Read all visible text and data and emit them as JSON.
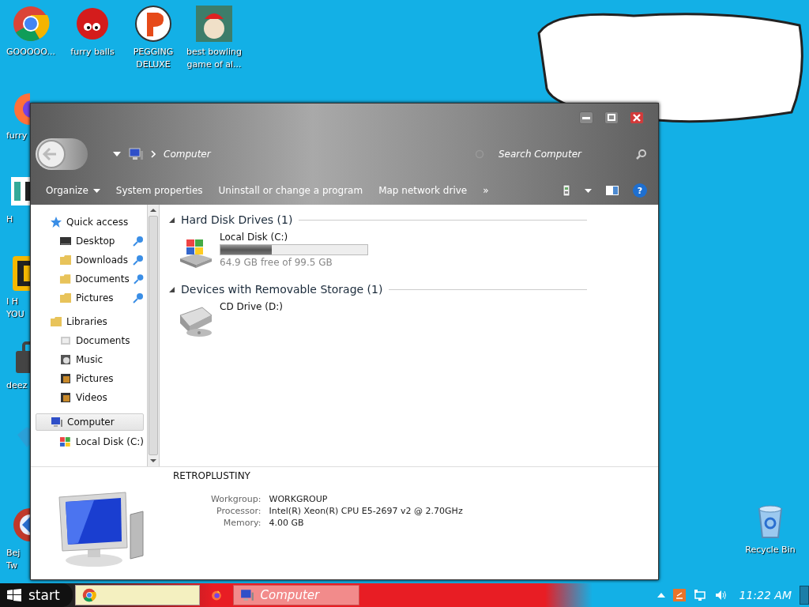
{
  "desktop": {
    "icons": [
      {
        "label": "GOOOOO...",
        "kind": "chrome"
      },
      {
        "label": "furry balls",
        "kind": "furball"
      },
      {
        "label": "PEGGING DELUXE",
        "kind": "peg"
      },
      {
        "label": "best bowling game of al...",
        "kind": "bowling"
      },
      {
        "label": "furry",
        "kind": "firefox"
      },
      {
        "label": "H",
        "kind": "hx"
      },
      {
        "label": "I H YOU",
        "kind": "dbox"
      },
      {
        "label": "deez",
        "kind": "bag"
      },
      {
        "label": "Bej Tw",
        "kind": "swirl"
      },
      {
        "label": "Recycle Bin",
        "kind": "bin"
      }
    ]
  },
  "window": {
    "address": {
      "crumb": "Computer"
    },
    "search": {
      "placeholder": "Search Computer"
    },
    "toolbar": [
      {
        "label": "Organize",
        "kind": "menu"
      },
      {
        "label": "System properties",
        "kind": "command"
      },
      {
        "label": "Uninstall or change a program",
        "kind": "command"
      },
      {
        "label": "Map network drive",
        "kind": "command"
      },
      {
        "label": "»",
        "kind": "overflow"
      }
    ],
    "help": "?",
    "nav": [
      {
        "label": "Quick access",
        "kind": "star",
        "selected": false,
        "children": [
          {
            "label": "Desktop",
            "kind": "desktop",
            "pinned": true,
            "selected": false
          },
          {
            "label": "Downloads",
            "kind": "folder",
            "pinned": true,
            "selected": false
          },
          {
            "label": "Documents",
            "kind": "folder",
            "pinned": true,
            "selected": false
          },
          {
            "label": "Pictures",
            "kind": "folder",
            "pinned": true,
            "selected": false
          }
        ]
      },
      {
        "label": "Libraries",
        "kind": "folder",
        "selected": false,
        "children": [
          {
            "label": "Documents",
            "kind": "doc",
            "pinned": false,
            "selected": false
          },
          {
            "label": "Music",
            "kind": "music",
            "pinned": false,
            "selected": false
          },
          {
            "label": "Pictures",
            "kind": "film",
            "pinned": false,
            "selected": false
          },
          {
            "label": "Videos",
            "kind": "film",
            "pinned": false,
            "selected": false
          }
        ]
      },
      {
        "label": "Computer",
        "kind": "computer",
        "selected": true,
        "children": [
          {
            "label": "Local Disk (C:)",
            "kind": "disk",
            "pinned": false,
            "selected": false
          }
        ]
      }
    ],
    "groups": [
      {
        "title": "Hard Disk Drives (1)",
        "expanded": true,
        "items": [
          {
            "name": "Local Disk (C:)",
            "kind": "disk",
            "level": 0.35,
            "reading": "64.9 GB free of 99.5 GB"
          }
        ]
      },
      {
        "title": "Devices with Removable Storage (1)",
        "expanded": true,
        "items": [
          {
            "name": "CD Drive (D:)",
            "kind": "cd"
          }
        ]
      }
    ],
    "details": {
      "name": "RETROPLUSTINY",
      "fields": [
        {
          "label": "Workgroup:",
          "value": "WORKGROUP"
        },
        {
          "label": "Processor:",
          "value": "Intel(R) Xeon(R) CPU E5-2697 v2 @ 2.70GHz"
        },
        {
          "label": "Memory:",
          "value": "4.00 GB"
        }
      ]
    }
  },
  "taskbar": {
    "start": "start",
    "buttons": [
      {
        "kind": "chrome",
        "selected": false
      },
      {
        "kind": "firefox",
        "selected": false
      },
      {
        "kind": "computer",
        "label": "Computer",
        "selected": true
      }
    ],
    "clock": "11:22 AM"
  }
}
